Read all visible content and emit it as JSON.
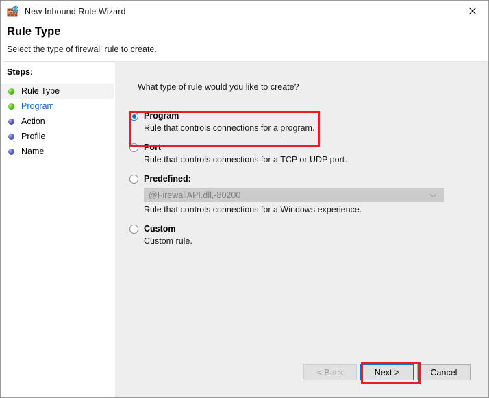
{
  "window": {
    "title": "New Inbound Rule Wizard",
    "icon": "firewall-wall-globe-icon",
    "close_label": "✕"
  },
  "header": {
    "title": "Rule Type",
    "subtitle": "Select the type of firewall rule to create."
  },
  "sidebar": {
    "heading": "Steps:",
    "items": [
      {
        "label": "Rule Type",
        "bullet": "green",
        "state": "current"
      },
      {
        "label": "Program",
        "bullet": "green",
        "state": "link"
      },
      {
        "label": "Action",
        "bullet": "blue",
        "state": "pending"
      },
      {
        "label": "Profile",
        "bullet": "blue",
        "state": "pending"
      },
      {
        "label": "Name",
        "bullet": "blue",
        "state": "pending"
      }
    ]
  },
  "main": {
    "question": "What type of rule would you like to create?",
    "options": [
      {
        "title": "Program",
        "description": "Rule that controls connections for a program.",
        "selected": true,
        "highlighted": true
      },
      {
        "title": "Port",
        "description": "Rule that controls connections for a TCP or UDP port.",
        "selected": false,
        "highlighted": false
      },
      {
        "title": "Predefined:",
        "description": "Rule that controls connections for a Windows experience.",
        "selected": false,
        "highlighted": false,
        "combo_value": "@FirewallAPI.dll,-80200",
        "combo_enabled": false
      },
      {
        "title": "Custom",
        "description": "Custom rule.",
        "selected": false,
        "highlighted": false
      }
    ]
  },
  "footer": {
    "back_label": "< Back",
    "next_label": "Next >",
    "cancel_label": "Cancel"
  },
  "colors": {
    "highlight_red": "#ec1c24",
    "accent_blue": "#1273c9",
    "link_blue": "#1063c4",
    "content_bg": "#efeeee"
  }
}
